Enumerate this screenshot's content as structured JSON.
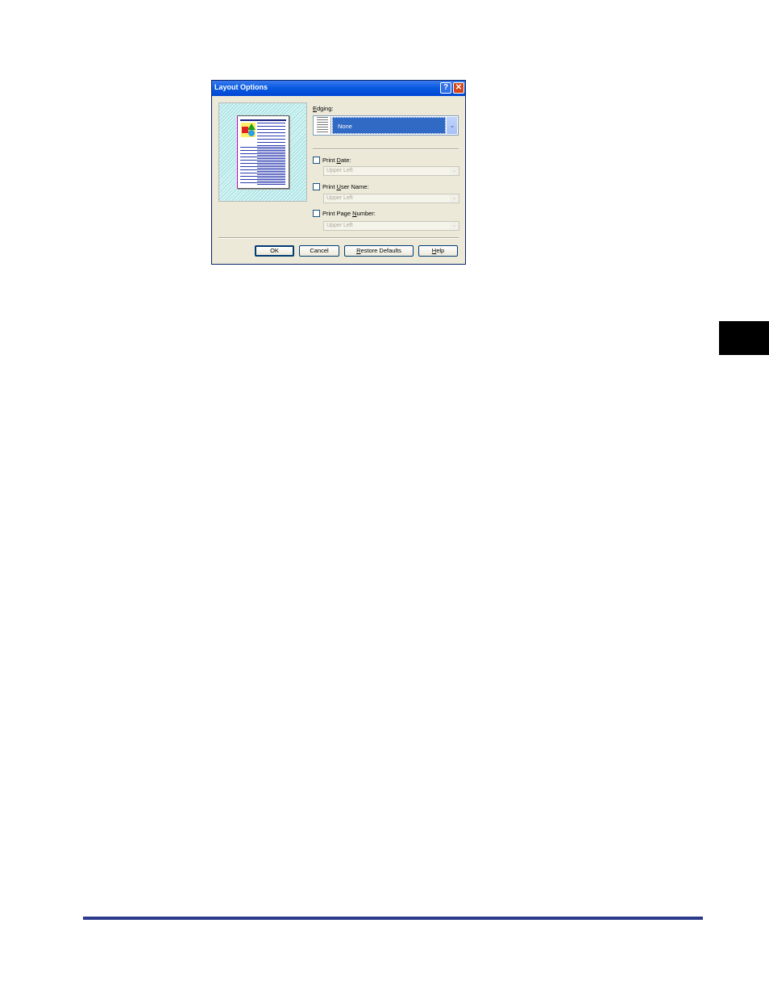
{
  "dialog": {
    "title": "Layout Options",
    "help_glyph": "?",
    "close_glyph": "✕"
  },
  "edging": {
    "label_mnemonic": "E",
    "label_rest": "dging:",
    "value": "None",
    "dropdown_glyph": "⌄"
  },
  "options": [
    {
      "label_before": "Print ",
      "mnemonic": "D",
      "label_after": "ate:",
      "value": "Upper Left",
      "checked": false
    },
    {
      "label_before": "Print ",
      "mnemonic": "U",
      "label_after": "ser Name:",
      "value": "Upper Left",
      "checked": false
    },
    {
      "label_before": "Print Page ",
      "mnemonic": "N",
      "label_after": "umber:",
      "value": "Upper Left",
      "checked": false
    }
  ],
  "buttons": {
    "ok": "OK",
    "cancel": "Cancel",
    "restore_mnemonic": "R",
    "restore_rest": "estore Defaults",
    "help_mnemonic": "H",
    "help_rest": "elp"
  },
  "colors": {
    "title_bar": "#0a5be0",
    "selection": "#316ac5",
    "footer_rule": "#2c3a8c",
    "side_tab": "#000000"
  }
}
